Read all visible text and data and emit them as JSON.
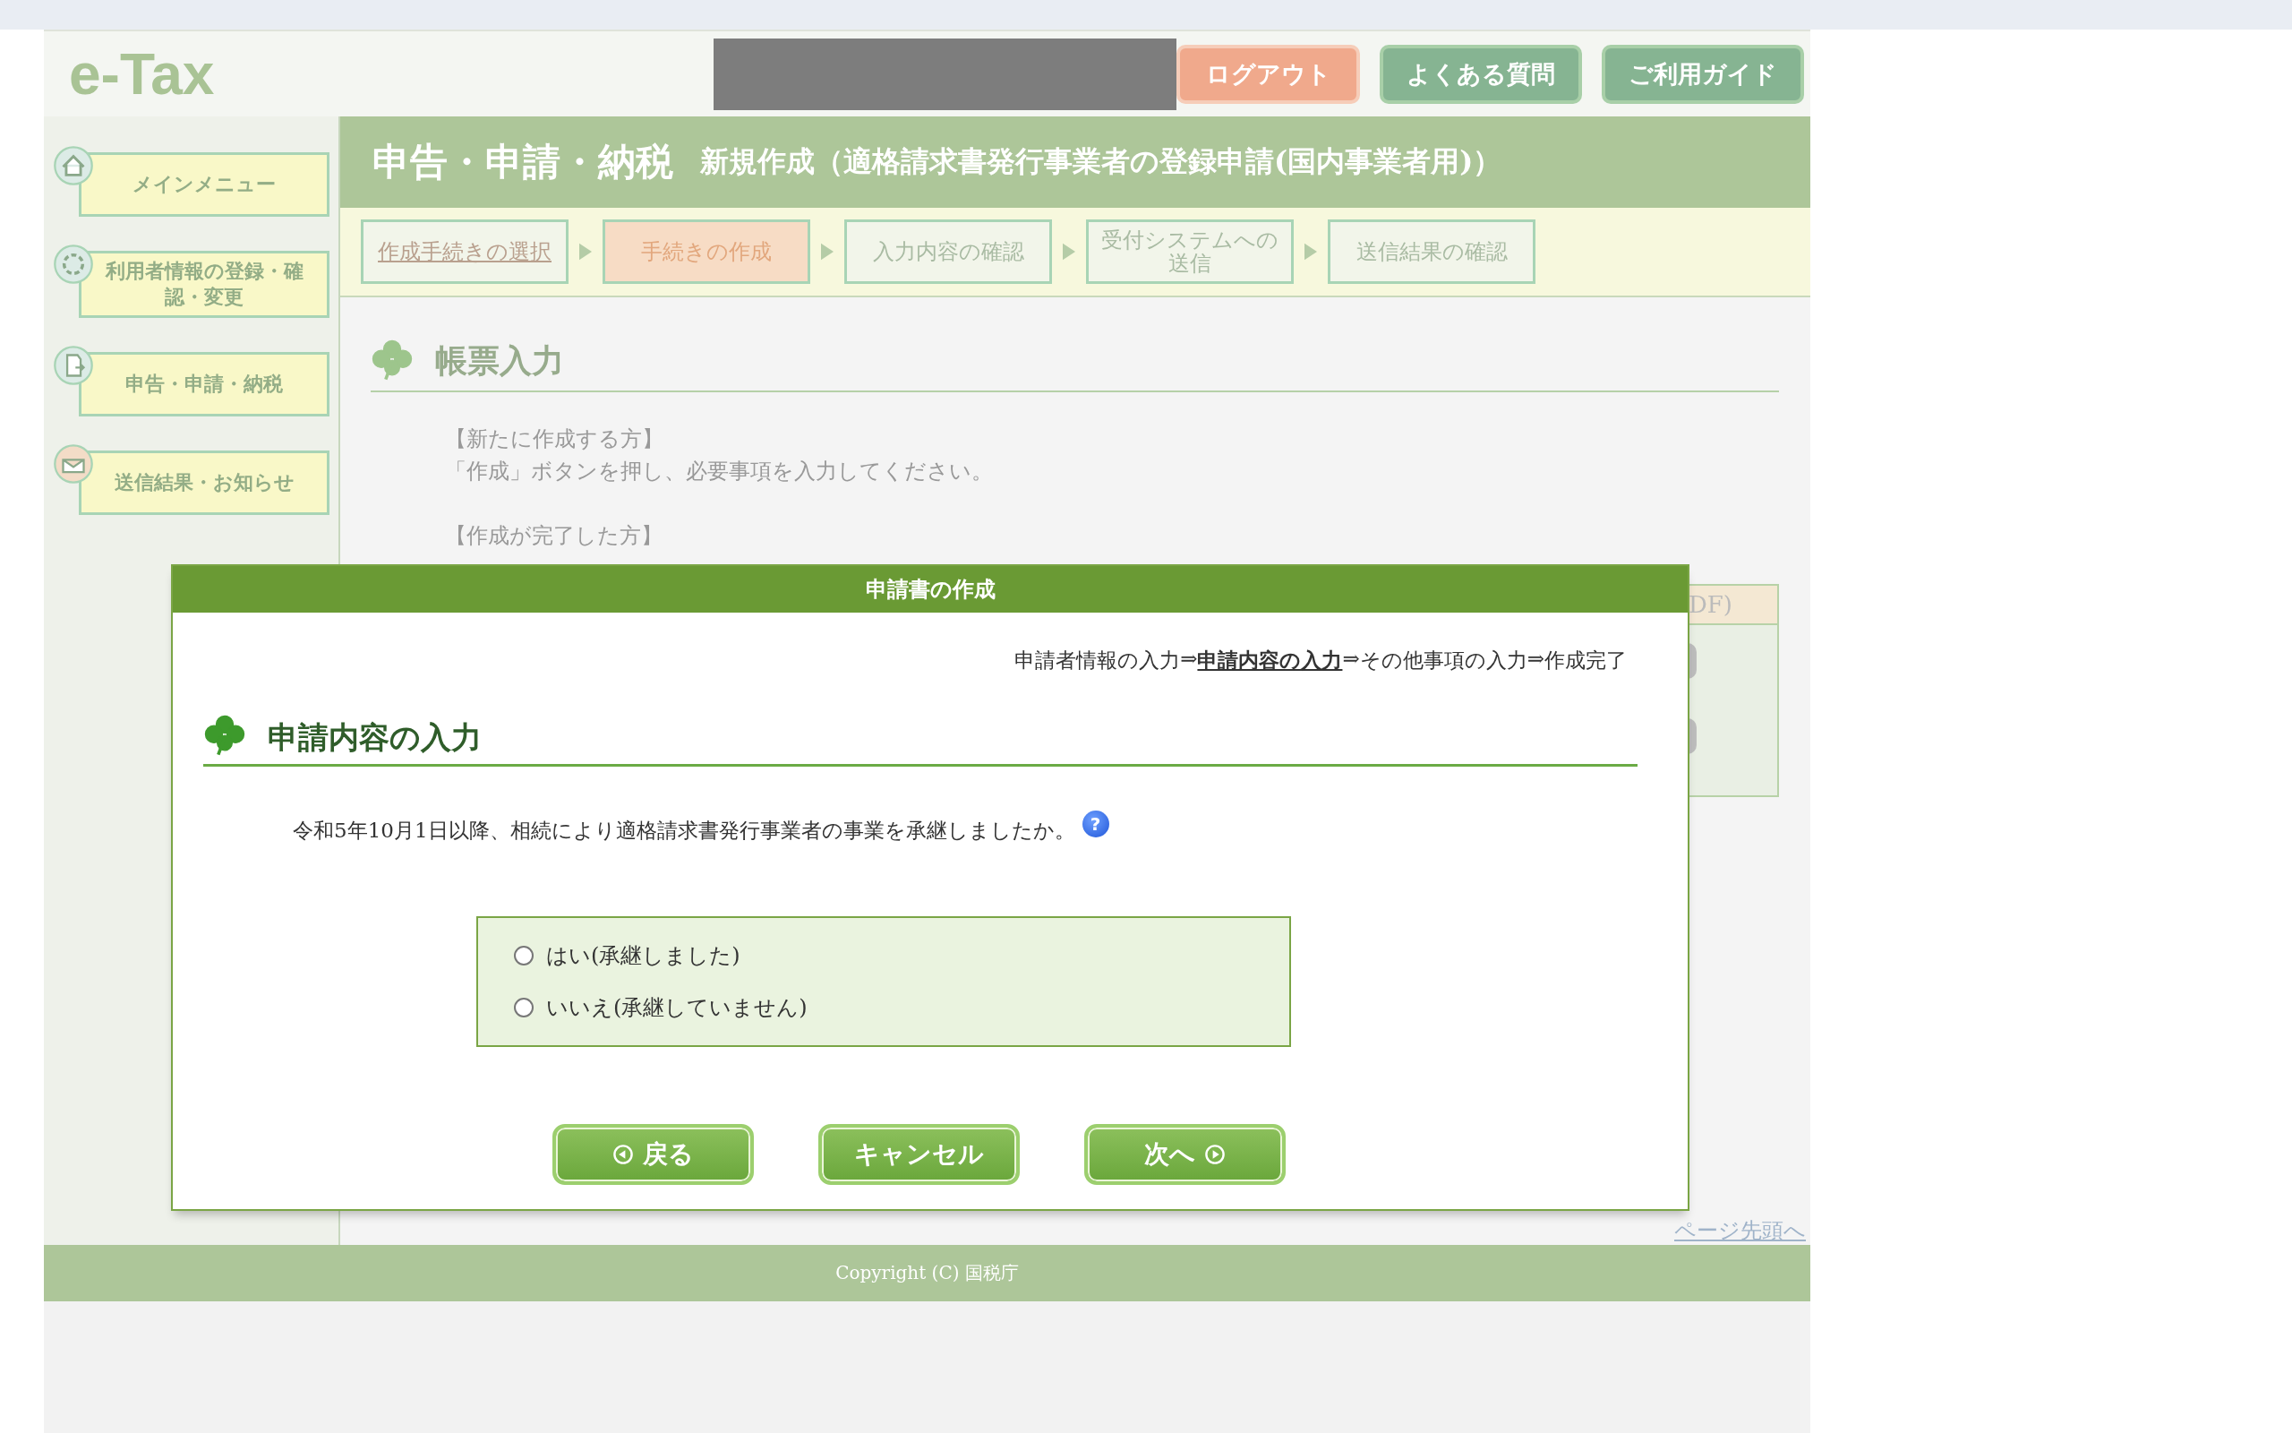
{
  "header": {
    "logo": "e-Tax",
    "buttons": [
      {
        "label": "ログアウト",
        "kind": "logout"
      },
      {
        "label": "よくある質問",
        "kind": "nav"
      },
      {
        "label": "ご利用ガイド",
        "kind": "nav"
      }
    ]
  },
  "sidebar": {
    "items": [
      {
        "label": "メインメニュー",
        "kind": "home"
      },
      {
        "label": "利用者情報の登録・確認・変更",
        "kind": "user"
      },
      {
        "label": "申告・申請・納税",
        "kind": "form"
      },
      {
        "label": "送信結果・お知らせ",
        "kind": "mail"
      }
    ]
  },
  "page": {
    "title": "申告・申請・納税",
    "subtitle": "新規作成（適格請求書発行事業者の登録申請(国内事業者用)）",
    "steps": [
      {
        "label": "作成手続きの選択",
        "done": true,
        "selected": false
      },
      {
        "label": "手続きの作成",
        "done": false,
        "selected": true
      },
      {
        "label": "入力内容の確認",
        "done": false,
        "selected": false
      },
      {
        "label": "受付システムへの送信",
        "done": false,
        "selected": false
      },
      {
        "label": "送信結果の確認",
        "done": false,
        "selected": false
      }
    ],
    "section_heading": "帳票入力",
    "paragraphs": [
      [
        "【新たに作成する方】",
        "「作成」ボタンを押し、必要事項を入力してください。"
      ],
      [
        "【作成が完了した方】"
      ]
    ],
    "panel_heading": "DF)",
    "back_to_top": "ページ先頭へ"
  },
  "dialog": {
    "title": "申請書の作成",
    "breadcrumb": [
      {
        "label": "申請者情報の入力",
        "kind": "step",
        "selected": false
      },
      {
        "label": "⇒",
        "kind": "arrow"
      },
      {
        "label": "申請内容の入力",
        "kind": "step",
        "selected": true
      },
      {
        "label": "⇒",
        "kind": "arrow"
      },
      {
        "label": "その他事項の入力",
        "kind": "step",
        "selected": false
      },
      {
        "label": "⇒",
        "kind": "arrow"
      },
      {
        "label": "作成完了",
        "kind": "step",
        "selected": false
      }
    ],
    "heading": "申請内容の入力",
    "question": "令和5年10月1日以降、相続により適格請求書発行事業者の事業を承継しましたか。",
    "help": "?",
    "options": [
      {
        "label": "はい(承継しました)",
        "selected": false
      },
      {
        "label": "いいえ(承継していません)",
        "selected": false
      }
    ],
    "buttons": [
      {
        "label": "戻る",
        "kind": "back"
      },
      {
        "label": "キャンセル",
        "kind": "cancel"
      },
      {
        "label": "次へ",
        "kind": "next"
      }
    ]
  },
  "footer": {
    "copyright": "Copyright (C) 国税庁"
  }
}
